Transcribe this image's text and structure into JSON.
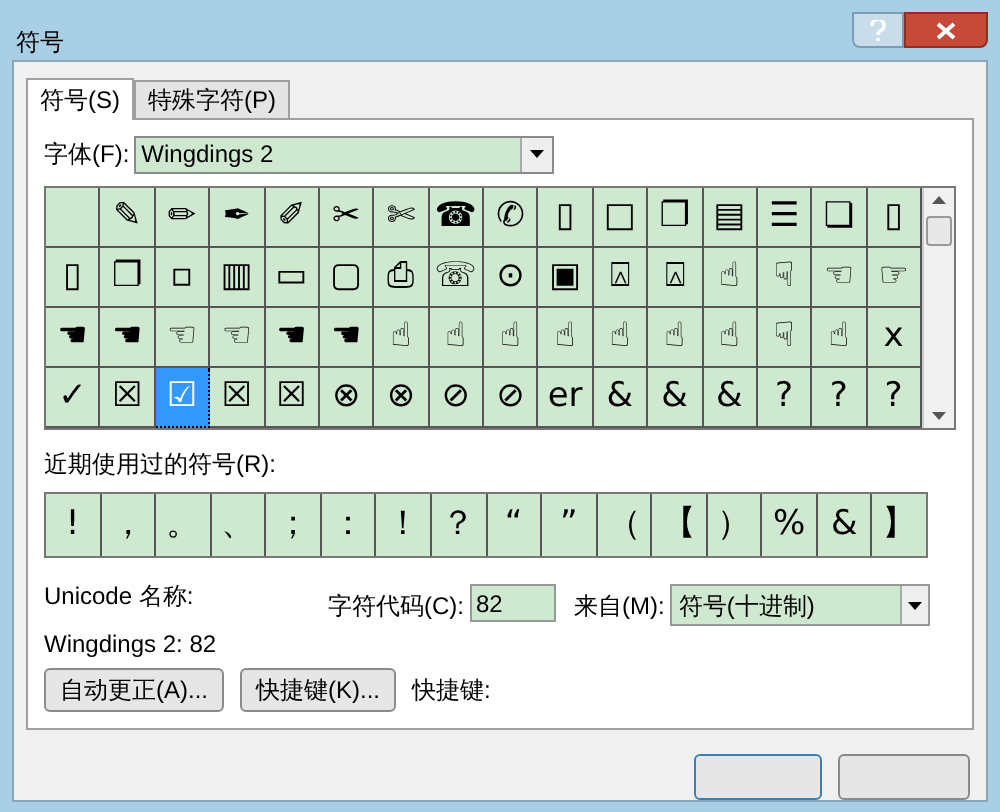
{
  "window": {
    "title": "符号"
  },
  "tabs": [
    {
      "label": "符号(S)",
      "selected": true
    },
    {
      "label": "特殊字符(P)",
      "selected": false
    }
  ],
  "font": {
    "label": "字体(F):",
    "value": "Wingdings 2"
  },
  "symbols": [
    [
      {
        "selected": false
      },
      {
        "char": "✎",
        "selected": false
      },
      {
        "char": "✏",
        "selected": false
      },
      {
        "char": "✒",
        "selected": false
      },
      {
        "char": "✐",
        "selected": false
      },
      {
        "char": "✂",
        "selected": false
      },
      {
        "char": "✄",
        "selected": false
      },
      {
        "char": "☎",
        "selected": false
      },
      {
        "char": "✆",
        "selected": false
      },
      {
        "char": "▯",
        "selected": false
      },
      {
        "char": "□",
        "selected": false
      },
      {
        "char": "❐",
        "selected": false
      },
      {
        "char": "▤",
        "selected": false
      },
      {
        "char": "☰",
        "selected": false
      },
      {
        "char": "❏",
        "selected": false
      },
      {
        "char": "▯",
        "selected": false
      }
    ],
    [
      {
        "char": "▯",
        "selected": false
      },
      {
        "char": "❐",
        "selected": false
      },
      {
        "char": "▫",
        "selected": false
      },
      {
        "char": "▥",
        "selected": false
      },
      {
        "char": "▭",
        "selected": false
      },
      {
        "char": "▢",
        "selected": false
      },
      {
        "char": "⎙",
        "selected": false
      },
      {
        "char": "☏",
        "selected": false
      },
      {
        "char": "⊙",
        "selected": false
      },
      {
        "char": "▣",
        "selected": false
      },
      {
        "char": "⍓",
        "selected": false
      },
      {
        "char": "⍓",
        "selected": false
      },
      {
        "char": "☝",
        "selected": false
      },
      {
        "char": "☟",
        "selected": false
      },
      {
        "char": "☜",
        "selected": false
      },
      {
        "char": "☞",
        "selected": false
      }
    ],
    [
      {
        "char": "☚",
        "selected": false
      },
      {
        "char": "☚",
        "selected": false
      },
      {
        "char": "☜",
        "selected": false
      },
      {
        "char": "☜",
        "selected": false
      },
      {
        "char": "☚",
        "selected": false
      },
      {
        "char": "☚",
        "selected": false
      },
      {
        "char": "☝",
        "selected": false
      },
      {
        "char": "☝",
        "selected": false
      },
      {
        "char": "☝",
        "selected": false
      },
      {
        "char": "☝",
        "selected": false
      },
      {
        "char": "☝",
        "selected": false
      },
      {
        "char": "☝",
        "selected": false
      },
      {
        "char": "☝",
        "selected": false
      },
      {
        "char": "☟",
        "selected": false
      },
      {
        "char": "☝",
        "selected": false
      },
      {
        "char": "x",
        "selected": false
      }
    ],
    [
      {
        "char": "✓",
        "selected": false
      },
      {
        "char": "☒",
        "selected": false
      },
      {
        "char": "☑",
        "selected": true
      },
      {
        "char": "☒",
        "selected": false
      },
      {
        "char": "☒",
        "selected": false
      },
      {
        "char": "⊗",
        "selected": false
      },
      {
        "char": "⊗",
        "selected": false
      },
      {
        "char": "⊘",
        "selected": false
      },
      {
        "char": "⊘",
        "selected": false
      },
      {
        "char": "er",
        "selected": false
      },
      {
        "char": "&",
        "selected": false
      },
      {
        "char": "&",
        "selected": false
      },
      {
        "char": "&",
        "selected": false
      },
      {
        "char": "?",
        "selected": false
      },
      {
        "char": "?",
        "selected": false
      },
      {
        "char": "?",
        "selected": false
      }
    ]
  ],
  "recent": {
    "label": "近期使用过的符号(R):",
    "symbols": [
      "!",
      "，",
      "。",
      "、",
      "；",
      "：",
      "！",
      "？",
      "“",
      "”",
      "（",
      "【",
      "）",
      "%",
      "&",
      "】"
    ]
  },
  "unicode_name": {
    "label": "Unicode 名称:",
    "value": "Wingdings 2: 82"
  },
  "char_code": {
    "label": "字符代码(C):",
    "value": "82"
  },
  "from": {
    "label": "来自(M):",
    "value": "符号(十进制)"
  },
  "buttons": [
    {
      "label": "自动更正(A)..."
    },
    {
      "label": "快捷键(K)..."
    }
  ],
  "shortcut": {
    "label": "快捷键:"
  }
}
